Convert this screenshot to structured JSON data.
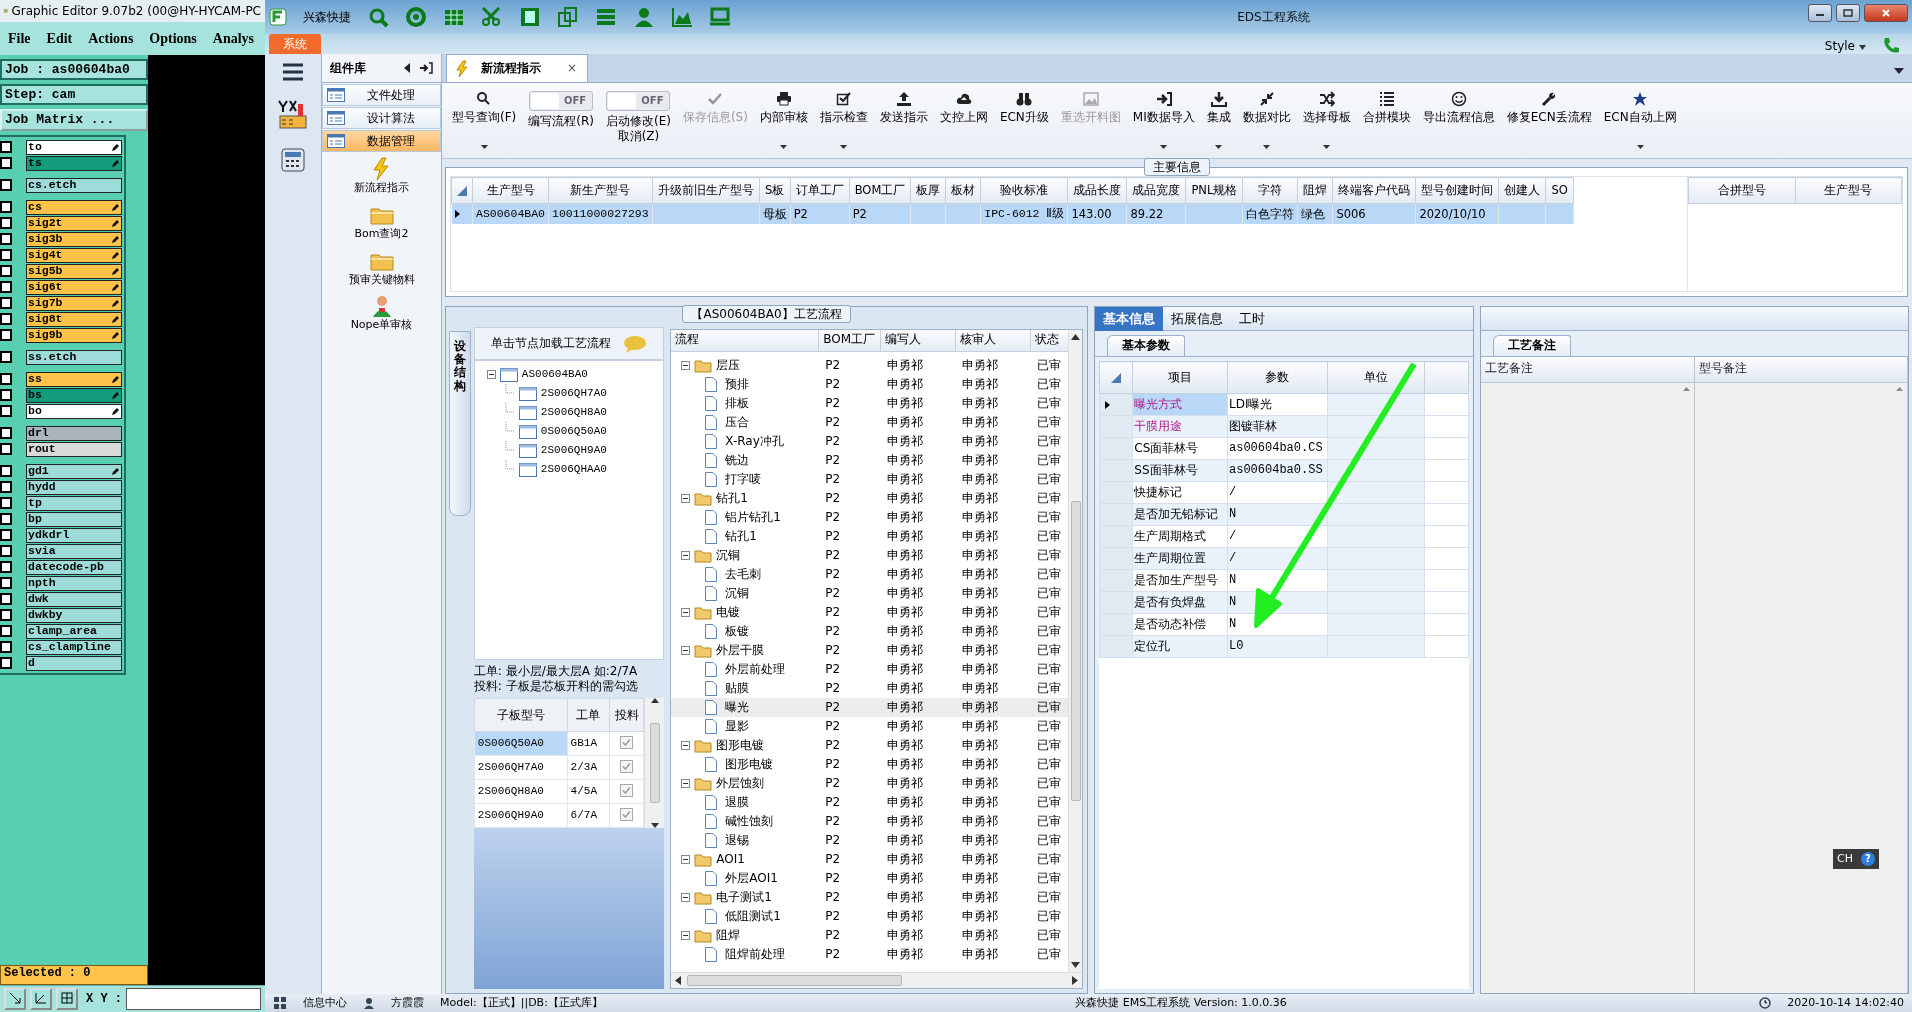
{
  "genesis": {
    "title": "Graphic Editor 9.07b2 (00@HY-HYCAM-PC",
    "menu": [
      "File",
      "Edit",
      "Actions",
      "Options",
      "Analys"
    ],
    "job": "Job : as00604ba0",
    "step": "Step: cam",
    "matrix_button": "Job Matrix ...",
    "layer_groups": [
      [
        {
          "name": "to",
          "color": "#ffffff",
          "marked": true,
          "checked": false
        },
        {
          "name": "ts",
          "color": "#139c7c",
          "marked": true,
          "checked": false
        }
      ],
      [
        {
          "name": "cs.etch",
          "color": "#9edcd9",
          "marked": false,
          "checked": false
        }
      ],
      [
        {
          "name": "cs",
          "color": "#ffc34a",
          "marked": true,
          "checked": false
        },
        {
          "name": "sig2t",
          "color": "#ffc34a",
          "marked": true,
          "checked": false
        },
        {
          "name": "sig3b",
          "color": "#ffc34a",
          "marked": true,
          "checked": false
        },
        {
          "name": "sig4t",
          "color": "#ffc34a",
          "marked": true,
          "checked": false
        },
        {
          "name": "sig5b",
          "color": "#ffc34a",
          "marked": true,
          "checked": false
        },
        {
          "name": "sig6t",
          "color": "#ffc34a",
          "marked": true,
          "checked": false
        },
        {
          "name": "sig7b",
          "color": "#ffc34a",
          "marked": true,
          "checked": false
        },
        {
          "name": "sig8t",
          "color": "#ffc34a",
          "marked": true,
          "checked": false
        },
        {
          "name": "sig9b",
          "color": "#ffc34a",
          "marked": true,
          "checked": false
        }
      ],
      [
        {
          "name": "ss.etch",
          "color": "#9edcd9",
          "marked": false,
          "checked": false
        }
      ],
      [
        {
          "name": "ss",
          "color": "#ffc34a",
          "marked": true,
          "checked": false
        },
        {
          "name": "bs",
          "color": "#139c7c",
          "marked": true,
          "checked": false
        },
        {
          "name": "bo",
          "color": "#ffffff",
          "marked": true,
          "checked": false
        }
      ],
      [
        {
          "name": "drl",
          "color": "#a9b4bc",
          "marked": false,
          "checked": false
        },
        {
          "name": "rout",
          "color": "#d9d9d9",
          "marked": false,
          "checked": false
        }
      ],
      [
        {
          "name": "gd1",
          "color": "#9edcd9",
          "marked": true,
          "checked": false
        },
        {
          "name": "hydd",
          "color": "#9edcd9",
          "marked": false,
          "checked": false
        },
        {
          "name": "tp",
          "color": "#9edcd9",
          "marked": false,
          "checked": false
        },
        {
          "name": "bp",
          "color": "#9edcd9",
          "marked": false,
          "checked": false
        },
        {
          "name": "ydkdrl",
          "color": "#9edcd9",
          "marked": false,
          "checked": false
        },
        {
          "name": "svia",
          "color": "#9edcd9",
          "marked": false,
          "checked": false
        },
        {
          "name": "datecode-pb",
          "color": "#9edcd9",
          "marked": false,
          "checked": false
        },
        {
          "name": "npth",
          "color": "#9edcd9",
          "marked": false,
          "checked": false
        },
        {
          "name": "dwk",
          "color": "#9edcd9",
          "marked": false,
          "checked": false
        },
        {
          "name": "dwkby",
          "color": "#9edcd9",
          "marked": false,
          "checked": false
        },
        {
          "name": "clamp_area",
          "color": "#9edcd9",
          "marked": false,
          "checked": false
        },
        {
          "name": "cs_clampline",
          "color": "#9edcd9",
          "marked": false,
          "checked": false
        },
        {
          "name": "d",
          "color": "#9edcd9",
          "marked": false,
          "checked": false
        }
      ]
    ],
    "selected": "Selected : 0",
    "xy_label": "X Y :"
  },
  "app": {
    "brand": "兴森快捷",
    "title": "EDS工程系统",
    "ribbon_tab": "系统",
    "style_menu": "Style"
  },
  "nav": {
    "title": "组件库",
    "items": [
      {
        "label": "文件处理",
        "selected": false
      },
      {
        "label": "设计算法",
        "selected": false
      },
      {
        "label": "数据管理",
        "selected": true
      }
    ],
    "launchers": [
      "新流程指示",
      "Bom查询2",
      "预审关键物料",
      "Nope单审核"
    ]
  },
  "doc_tab": {
    "label": "新流程指示",
    "close": "×"
  },
  "toolbar": [
    {
      "kind": "button",
      "label": "型号查询(F)",
      "disabled": false,
      "dropdown": true
    },
    {
      "kind": "toggle",
      "label": "编写流程(R)",
      "switch_text": "OFF",
      "on": false
    },
    {
      "kind": "toggle",
      "label": "启动修改(E)",
      "second_label": "取消(Z)",
      "switch_text": "OFF",
      "on": false
    },
    {
      "kind": "button",
      "label": "保存信息(S)",
      "disabled": true,
      "dropdown": false
    },
    {
      "kind": "button",
      "label": "内部审核",
      "disabled": false,
      "dropdown": true
    },
    {
      "kind": "button",
      "label": "指示检查",
      "disabled": false,
      "dropdown": true
    },
    {
      "kind": "button",
      "label": "发送指示",
      "disabled": false,
      "dropdown": false
    },
    {
      "kind": "button",
      "label": "文控上网",
      "disabled": false,
      "dropdown": false
    },
    {
      "kind": "button",
      "label": "ECN升级",
      "disabled": false,
      "dropdown": false
    },
    {
      "kind": "button",
      "label": "重选开料图",
      "disabled": true,
      "dropdown": false
    },
    {
      "kind": "button",
      "label": "MI数据导入",
      "disabled": false,
      "dropdown": true
    },
    {
      "kind": "button",
      "label": "集成",
      "disabled": false,
      "dropdown": true
    },
    {
      "kind": "button",
      "label": "数据对比",
      "disabled": false,
      "dropdown": true
    },
    {
      "kind": "button",
      "label": "选择母板",
      "disabled": false,
      "dropdown": true
    },
    {
      "kind": "button",
      "label": "合拼模块",
      "disabled": false,
      "dropdown": false
    },
    {
      "kind": "button",
      "label": "导出流程信息",
      "disabled": false,
      "dropdown": false
    },
    {
      "kind": "button",
      "label": "修复ECN丢流程",
      "disabled": false,
      "dropdown": false
    },
    {
      "kind": "button",
      "label": "ECN自动上网",
      "disabled": false,
      "dropdown": true
    }
  ],
  "main_info": {
    "title": "主要信息",
    "columns": [
      "生产型号",
      "新生产型号",
      "升级前旧生产型号",
      "S板",
      "订单工厂",
      "BOM工厂",
      "板厚",
      "板材",
      "验收标准",
      "成品长度",
      "成品宽度",
      "PNL规格",
      "字符",
      "阻焊",
      "终端客户代码",
      "型号创建时间",
      "创建人",
      "SO"
    ],
    "rows": [
      {
        "selected": true,
        "cells": [
          "AS00604BA0",
          "10011000027293",
          null,
          "母板",
          "P2",
          "P2",
          null,
          null,
          "IPC-6012 Ⅱ级",
          "143.00",
          "89.22",
          null,
          "白色字符",
          "绿色",
          "S006",
          "2020/10/10",
          null,
          null
        ]
      }
    ],
    "side_columns": [
      "合拼型号",
      "生产型号"
    ]
  },
  "process": {
    "title": "【AS00604BA0】工艺流程",
    "side_tab": "设备结构",
    "hint": "单击节点加载工艺流程",
    "tree": {
      "label": "AS00604BA0",
      "expanded": true,
      "children": [
        "2S006QH7A0",
        "2S006QH8A0",
        "0S006Q50A0",
        "2S006QH9A0",
        "2S006QHAA0"
      ]
    },
    "notes": [
      "工单: 最小层/最大层A 如:2/7A",
      "投料: 子板是芯板开料的需勾选"
    ],
    "boards": {
      "columns": [
        "子板型号",
        "工单",
        "投料"
      ],
      "rows": [
        {
          "board": "0S006Q50A0",
          "order": "GB1A",
          "checked": true,
          "selected": true
        },
        {
          "board": "2S006QH7A0",
          "order": "2/3A",
          "checked": true,
          "selected": false
        },
        {
          "board": "2S006QH8A0",
          "order": "4/5A",
          "checked": true,
          "selected": false
        },
        {
          "board": "2S006QH9A0",
          "order": "6/7A",
          "checked": true,
          "selected": false
        }
      ]
    },
    "flow_columns": [
      "流程",
      "BOM工厂",
      "编写人",
      "核审人",
      "状态"
    ],
    "flow": [
      {
        "name": "层压",
        "bom": "P2",
        "writer": "申勇祁",
        "reviewer": "申勇祁",
        "status": "已审",
        "selected": false,
        "expanded": true,
        "children": [
          {
            "name": "预排",
            "bom": "P2",
            "writer": "申勇祁",
            "reviewer": "申勇祁",
            "status": "已审",
            "selected": false
          },
          {
            "name": "排板",
            "bom": "P2",
            "writer": "申勇祁",
            "reviewer": "申勇祁",
            "status": "已审",
            "selected": false
          },
          {
            "name": "压合",
            "bom": "P2",
            "writer": "申勇祁",
            "reviewer": "申勇祁",
            "status": "已审",
            "selected": false
          },
          {
            "name": "X-Ray冲孔",
            "bom": "P2",
            "writer": "申勇祁",
            "reviewer": "申勇祁",
            "status": "已审",
            "selected": false
          },
          {
            "name": "铣边",
            "bom": "P2",
            "writer": "申勇祁",
            "reviewer": "申勇祁",
            "status": "已审",
            "selected": false
          },
          {
            "name": "打字唛",
            "bom": "P2",
            "writer": "申勇祁",
            "reviewer": "申勇祁",
            "status": "已审",
            "selected": false
          }
        ]
      },
      {
        "name": "钻孔1",
        "bom": "P2",
        "writer": "申勇祁",
        "reviewer": "申勇祁",
        "status": "已审",
        "selected": false,
        "expanded": true,
        "children": [
          {
            "name": "铝片钻孔1",
            "bom": "P2",
            "writer": "申勇祁",
            "reviewer": "申勇祁",
            "status": "已审",
            "selected": false
          },
          {
            "name": "钻孔1",
            "bom": "P2",
            "writer": "申勇祁",
            "reviewer": "申勇祁",
            "status": "已审",
            "selected": false
          }
        ]
      },
      {
        "name": "沉铜",
        "bom": "P2",
        "writer": "申勇祁",
        "reviewer": "申勇祁",
        "status": "已审",
        "selected": false,
        "expanded": true,
        "children": [
          {
            "name": "去毛刺",
            "bom": "P2",
            "writer": "申勇祁",
            "reviewer": "申勇祁",
            "status": "已审",
            "selected": false
          },
          {
            "name": "沉铜",
            "bom": "P2",
            "writer": "申勇祁",
            "reviewer": "申勇祁",
            "status": "已审",
            "selected": false
          }
        ]
      },
      {
        "name": "电镀",
        "bom": "P2",
        "writer": "申勇祁",
        "reviewer": "申勇祁",
        "status": "已审",
        "selected": false,
        "expanded": true,
        "children": [
          {
            "name": "板镀",
            "bom": "P2",
            "writer": "申勇祁",
            "reviewer": "申勇祁",
            "status": "已审",
            "selected": false
          }
        ]
      },
      {
        "name": "外层干膜",
        "bom": "P2",
        "writer": "申勇祁",
        "reviewer": "申勇祁",
        "status": "已审",
        "selected": false,
        "expanded": true,
        "children": [
          {
            "name": "外层前处理",
            "bom": "P2",
            "writer": "申勇祁",
            "reviewer": "申勇祁",
            "status": "已审",
            "selected": false
          },
          {
            "name": "贴膜",
            "bom": "P2",
            "writer": "申勇祁",
            "reviewer": "申勇祁",
            "status": "已审",
            "selected": false
          },
          {
            "name": "曝光",
            "bom": "P2",
            "writer": "申勇祁",
            "reviewer": "申勇祁",
            "status": "已审",
            "selected": true
          },
          {
            "name": "显影",
            "bom": "P2",
            "writer": "申勇祁",
            "reviewer": "申勇祁",
            "status": "已审",
            "selected": false
          }
        ]
      },
      {
        "name": "图形电镀",
        "bom": "P2",
        "writer": "申勇祁",
        "reviewer": "申勇祁",
        "status": "已审",
        "selected": false,
        "expanded": true,
        "children": [
          {
            "name": "图形电镀",
            "bom": "P2",
            "writer": "申勇祁",
            "reviewer": "申勇祁",
            "status": "已审",
            "selected": false
          }
        ]
      },
      {
        "name": "外层蚀刻",
        "bom": "P2",
        "writer": "申勇祁",
        "reviewer": "申勇祁",
        "status": "已审",
        "selected": false,
        "expanded": true,
        "children": [
          {
            "name": "退膜",
            "bom": "P2",
            "writer": "申勇祁",
            "reviewer": "申勇祁",
            "status": "已审",
            "selected": false
          },
          {
            "name": "碱性蚀刻",
            "bom": "P2",
            "writer": "申勇祁",
            "reviewer": "申勇祁",
            "status": "已审",
            "selected": false
          },
          {
            "name": "退锡",
            "bom": "P2",
            "writer": "申勇祁",
            "reviewer": "申勇祁",
            "status": "已审",
            "selected": false
          }
        ]
      },
      {
        "name": "AOI1",
        "bom": "P2",
        "writer": "申勇祁",
        "reviewer": "申勇祁",
        "status": "已审",
        "selected": false,
        "expanded": true,
        "children": [
          {
            "name": "外层AOI1",
            "bom": "P2",
            "writer": "申勇祁",
            "reviewer": "申勇祁",
            "status": "已审",
            "selected": false
          }
        ]
      },
      {
        "name": "电子测试1",
        "bom": "P2",
        "writer": "申勇祁",
        "reviewer": "申勇祁",
        "status": "已审",
        "selected": false,
        "expanded": true,
        "children": [
          {
            "name": "低阻测试1",
            "bom": "P2",
            "writer": "申勇祁",
            "reviewer": "申勇祁",
            "status": "已审",
            "selected": false
          }
        ]
      },
      {
        "name": "阻焊",
        "bom": "P2",
        "writer": "申勇祁",
        "reviewer": "申勇祁",
        "status": "已审",
        "selected": false,
        "expanded": true,
        "children": [
          {
            "name": "阻焊前处理",
            "bom": "P2",
            "writer": "申勇祁",
            "reviewer": "申勇祁",
            "status": "已审",
            "selected": false
          }
        ]
      }
    ]
  },
  "info": {
    "tabs": [
      {
        "label": "基本信息",
        "selected": true
      },
      {
        "label": "拓展信息",
        "selected": false
      },
      {
        "label": "工时",
        "selected": false
      }
    ],
    "sub_tab": "基本参数",
    "columns": [
      "项目",
      "参数",
      "单位"
    ],
    "rows": [
      {
        "item": "曝光方式",
        "value": "LDI曝光",
        "highlighted": true,
        "selected": true
      },
      {
        "item": "干膜用途",
        "value": "图镀菲林",
        "highlighted": true,
        "selected": false
      },
      {
        "item": "CS面菲林号",
        "value": "as00604ba0.CS",
        "highlighted": false,
        "selected": false
      },
      {
        "item": "SS面菲林号",
        "value": "as00604ba0.SS",
        "highlighted": false,
        "selected": false
      },
      {
        "item": "快捷标记",
        "value": "/",
        "highlighted": false,
        "selected": false
      },
      {
        "item": "是否加无铅标记",
        "value": "N",
        "highlighted": false,
        "selected": false
      },
      {
        "item": "生产周期格式",
        "value": "/",
        "highlighted": false,
        "selected": false
      },
      {
        "item": "生产周期位置",
        "value": "/",
        "highlighted": false,
        "selected": false
      },
      {
        "item": "是否加生产型号",
        "value": "N",
        "highlighted": false,
        "selected": false
      },
      {
        "item": "是否有负焊盘",
        "value": "N",
        "highlighted": false,
        "selected": false
      },
      {
        "item": "是否动态补偿",
        "value": "N",
        "highlighted": false,
        "selected": false
      },
      {
        "item": "定位孔",
        "value": "L0",
        "highlighted": false,
        "selected": false
      }
    ]
  },
  "remarks": {
    "tab": "工艺备注",
    "columns": [
      "工艺备注",
      "型号备注"
    ]
  },
  "ime": {
    "label": "CH",
    "help": "?"
  },
  "status_bar": {
    "items": [
      "信息中心",
      "方霞霞",
      "Model:【正式】||DB:【正式库】"
    ],
    "version": "兴森快捷 EMS工程系统 Version: 1.0.0.36",
    "time": "2020-10-14 14:02:40"
  }
}
